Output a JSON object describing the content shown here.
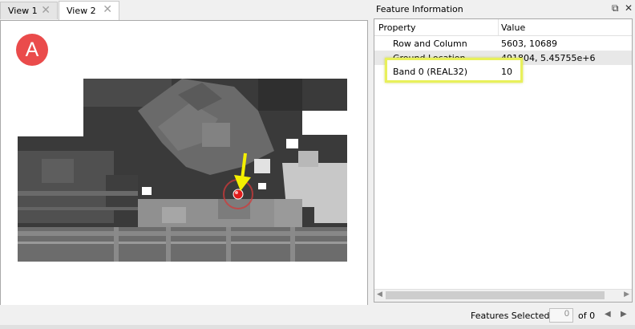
{
  "tabs": [
    {
      "label": "View 1",
      "active": false
    },
    {
      "label": "View 2",
      "active": true
    }
  ],
  "view": {
    "badge": "A"
  },
  "panel": {
    "title": "Feature Information",
    "columns": {
      "property": "Property",
      "value": "Value"
    },
    "rows": [
      {
        "property": "Row and Column",
        "value": "5603, 10689"
      },
      {
        "property": "Ground Location",
        "value": "491804, 5.45755e+6"
      },
      {
        "property": "Band 0 (REAL32)",
        "value": "10"
      }
    ],
    "highlighted_row": "Band 0 (REAL32)"
  },
  "footer": {
    "features_selected_label": "Features Selected:",
    "selected_count": "0",
    "of_total": "of 0"
  },
  "colors": {
    "highlight": "#e8f05a",
    "badge": "#ea4b4b",
    "arrow": "#f4f000",
    "marker": "#e01b1b"
  },
  "icons": [
    "close-icon",
    "restore-icon",
    "yellow-arrow-icon",
    "location-marker-icon",
    "nav-left-icon",
    "nav-right-icon"
  ]
}
